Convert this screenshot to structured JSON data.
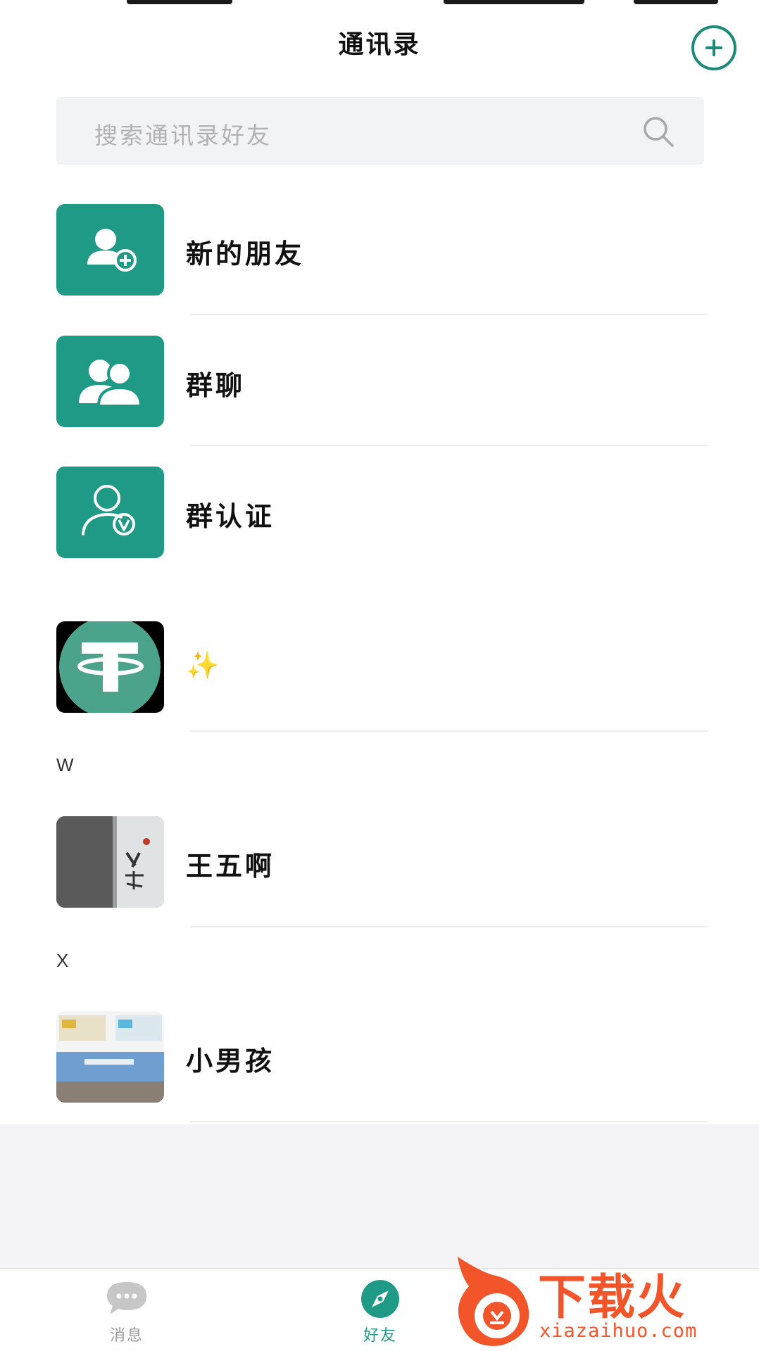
{
  "header": {
    "title": "通讯录"
  },
  "search": {
    "placeholder": "搜索通讯录好友"
  },
  "features": [
    {
      "label": "新的朋友",
      "icon": "add-friend-icon"
    },
    {
      "label": "群聊",
      "icon": "group-chat-icon"
    },
    {
      "label": "群认证",
      "icon": "group-verify-icon"
    }
  ],
  "contacts_top": [
    {
      "name": "✨",
      "avatar": "tether-logo-avatar"
    }
  ],
  "sections": [
    {
      "letter": "W",
      "contacts": [
        {
          "name": "王五啊",
          "avatar": "photo-avatar-book"
        }
      ]
    },
    {
      "letter": "X",
      "contacts": [
        {
          "name": "小男孩",
          "avatar": "photo-avatar-poster"
        }
      ]
    }
  ],
  "tabbar": {
    "tabs": [
      {
        "label": "消息",
        "icon": "chat-bubble-icon",
        "active": false
      },
      {
        "label": "好友",
        "icon": "compass-icon",
        "active": true
      }
    ]
  },
  "watermark": {
    "brand": "下载火",
    "url": "xiazaihuo.com"
  },
  "colors": {
    "accent": "#1f9a86",
    "watermark": "#f2552a",
    "search_bg": "#f2f3f5"
  }
}
